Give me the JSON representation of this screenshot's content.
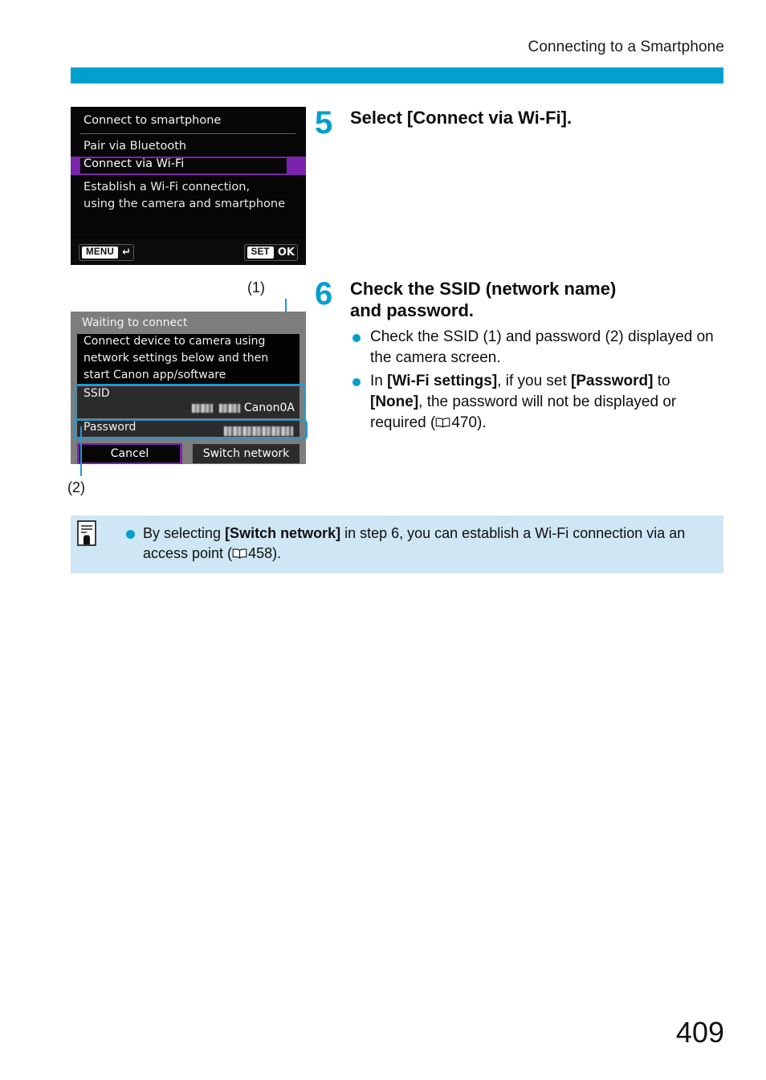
{
  "header": {
    "running_head": "Connecting to a Smartphone"
  },
  "page": {
    "number": "409"
  },
  "accent_colors": {
    "cyan": "#00a0ce",
    "leader_blue": "#1b9ad6",
    "selection_purple": "#7b22ae",
    "note_box_blue": "#cfe6f4"
  },
  "screen1": {
    "title": "Connect to smartphone",
    "items": [
      {
        "label": "Pair via Bluetooth",
        "selected": false
      },
      {
        "label": "Connect via Wi-Fi",
        "selected": true
      }
    ],
    "description_line1": "Establish a Wi-Fi connection,",
    "description_line2": "using the camera and smartphone",
    "footer": {
      "menu_chip": "MENU",
      "menu_glyph": "return-arrow-icon",
      "set_chip": "SET",
      "set_label": "OK"
    }
  },
  "screen2": {
    "title": "Waiting to connect",
    "message_line1": "Connect device to camera using",
    "message_line2": "network settings below and then",
    "message_line3": "start Canon app/software",
    "ssid_label": "SSID",
    "ssid_value_suffix": "Canon0A",
    "ssid_value_redacted": true,
    "password_label": "Password",
    "password_value_redacted": true,
    "cancel_button": "Cancel",
    "switch_network_button": "Switch network"
  },
  "callouts": {
    "one": "(1)",
    "two": "(2)"
  },
  "steps": [
    {
      "number": "5",
      "heading": "Select [Connect via Wi-Fi].",
      "bullets": []
    },
    {
      "number": "6",
      "heading_line1": "Check the SSID (network name)",
      "heading_line2": "and password.",
      "bullets": [
        {
          "parts": [
            {
              "text": "Check the SSID (1) and password (2) displayed on the camera screen.",
              "bold": false
            }
          ]
        },
        {
          "parts": [
            {
              "text": "In ",
              "bold": false
            },
            {
              "text": "[Wi-Fi settings]",
              "bold": true
            },
            {
              "text": ", if you set ",
              "bold": false
            },
            {
              "text": "[Password]",
              "bold": true
            },
            {
              "text": " to ",
              "bold": false
            },
            {
              "text": "[None]",
              "bold": true
            },
            {
              "text": ", the password will not be displayed or required (",
              "bold": false
            },
            {
              "icon": "book-reference-icon"
            },
            {
              "text": "470).",
              "bold": false
            }
          ]
        }
      ]
    }
  ],
  "note": {
    "icon": "note-pencil-icon",
    "parts": [
      {
        "text": "By selecting ",
        "bold": false
      },
      {
        "text": "[Switch network]",
        "bold": true
      },
      {
        "text": " in step 6, you can establish a Wi-Fi connection via an access point (",
        "bold": false
      },
      {
        "icon": "book-reference-icon"
      },
      {
        "text": "458).",
        "bold": false
      }
    ]
  }
}
